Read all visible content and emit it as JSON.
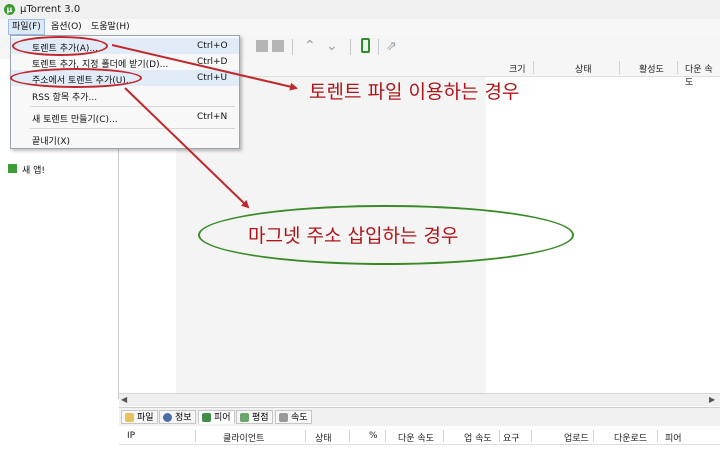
{
  "window": {
    "title": "μTorrent 3.0"
  },
  "menubar": {
    "items": [
      "파일(F)",
      "옵션(O)",
      "도움말(H)"
    ]
  },
  "file_menu": {
    "items": [
      {
        "label": "토렌트 추가(A)...",
        "shortcut": "Ctrl+O"
      },
      {
        "label": "토렌트 추가, 지정 폴더에 받기(D)...",
        "shortcut": "Ctrl+D"
      },
      {
        "label": "주소에서 토렌트 추가(U)...",
        "shortcut": "Ctrl+U"
      },
      {
        "label": "RSS 항목 추가...",
        "shortcut": ""
      },
      {
        "label": "새 토렌트 만들기(C)...",
        "shortcut": "Ctrl+N"
      },
      {
        "label": "끝내기(X)",
        "shortcut": ""
      }
    ]
  },
  "sidebar": {
    "item": "새 앱!"
  },
  "torrent_list": {
    "columns": [
      "크기",
      "상태",
      "활성도",
      "다운 속도"
    ]
  },
  "detail_tabs": [
    "파일",
    "정보",
    "피어",
    "평점",
    "속도"
  ],
  "peer_columns": [
    "IP",
    "클라이언트",
    "상태",
    "%",
    "다운 속도",
    "업 속도",
    "요구",
    "업로드",
    "다운로드",
    "피어"
  ],
  "annotations": {
    "note_file": "토렌트 파일 이용하는 경우",
    "note_magnet": "마그넷 주소 삽입하는 경우"
  },
  "colors": {
    "annotation_red": "#b01418",
    "ellipse_green": "#3a8a27",
    "app_green": "#3a9a2e"
  },
  "icons": [
    "utorrent-logo-icon",
    "phone-icon",
    "share-icon",
    "app-icon",
    "file-tab-icon",
    "info-tab-icon",
    "peers-tab-icon",
    "rating-tab-icon",
    "speed-tab-icon"
  ]
}
